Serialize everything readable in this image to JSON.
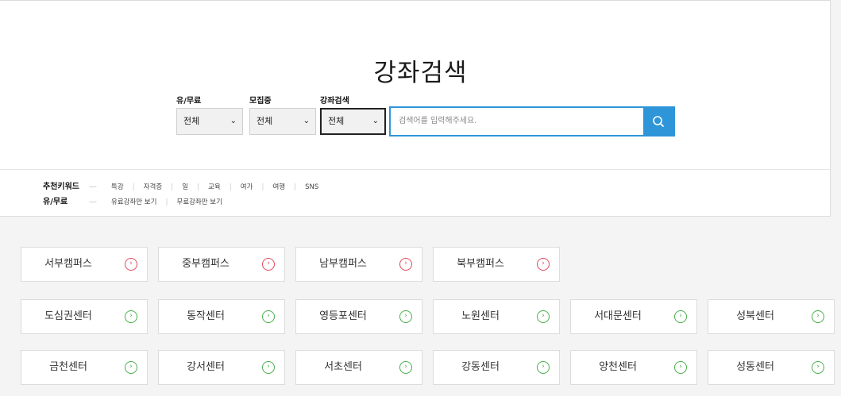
{
  "title": "강좌검색",
  "filters": [
    {
      "label": "유/무료",
      "value": "전체"
    },
    {
      "label": "모집중",
      "value": "전체"
    },
    {
      "label": "강좌검색",
      "value": "전체"
    }
  ],
  "search": {
    "placeholder": "검색어를 입력해주세요."
  },
  "keywords": {
    "title": "추천키워드",
    "items": [
      "특강",
      "자격증",
      "일",
      "교육",
      "여가",
      "여행",
      "SNS"
    ]
  },
  "paid": {
    "title": "유/무료",
    "items": [
      "유료강좌만 보기",
      "무료강좌만 보기"
    ]
  },
  "campuses": [
    "서부캠퍼스",
    "중부캠퍼스",
    "남부캠퍼스",
    "북부캠퍼스"
  ],
  "centers_row1": [
    "도심권센터",
    "동작센터",
    "영등포센터",
    "노원센터",
    "서대문센터",
    "성북센터"
  ],
  "centers_row2": [
    "금천센터",
    "강서센터",
    "서초센터",
    "강동센터",
    "양천센터",
    "성동센터"
  ],
  "colors": {
    "accent": "#2f95d9",
    "campus_icon": "#e3485a",
    "center_icon": "#48b04a"
  },
  "icons": {
    "search": "search-icon",
    "card_arrow": "chevron-right-circle-icon",
    "select": "chevron-down-icon"
  }
}
